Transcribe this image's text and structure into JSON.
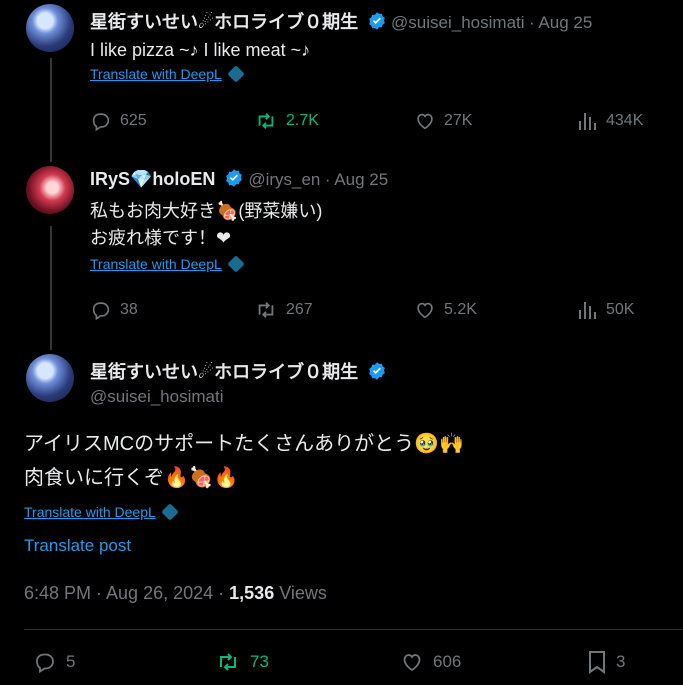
{
  "tweet1": {
    "name": "星街すいせい☄ホロライブ０期生",
    "handle": "@suisei_hosimati",
    "date": "· Aug 25",
    "text": "I like pizza ~♪ I like meat ~♪",
    "deepl": "Translate with DeepL",
    "replies": "625",
    "reposts": "2.7K",
    "likes": "27K",
    "views": "434K"
  },
  "tweet2": {
    "name": "IRyS💎holoEN",
    "handle": "@irys_en",
    "date": "· Aug 25",
    "text_line1": "私もお肉大好き🍖(野菜嫌い)",
    "text_line2": "お疲れ様です！❤",
    "deepl": "Translate with DeepL",
    "replies": "38",
    "reposts": "267",
    "likes": "5.2K",
    "views": "50K"
  },
  "main": {
    "name": "星街すいせい☄ホロライブ０期生",
    "handle": "@suisei_hosimati",
    "text_line1": "アイリスMCのサポートたくさんありがとう🥹🙌",
    "text_line2": "肉食いに行くぞ🔥🍖🔥",
    "deepl": "Translate with DeepL",
    "translate_post": "Translate post",
    "timestamp": "6:48 PM · Aug 26, 2024 ·",
    "views_count": "1,536",
    "views_label": "Views",
    "replies": "5",
    "reposts": "73",
    "likes": "606",
    "bookmarks": "3"
  },
  "colors": {
    "accent": "#1d9bf0",
    "repost_active": "#00ba7c",
    "muted": "#71767b",
    "verified": "#1d9bf0"
  }
}
